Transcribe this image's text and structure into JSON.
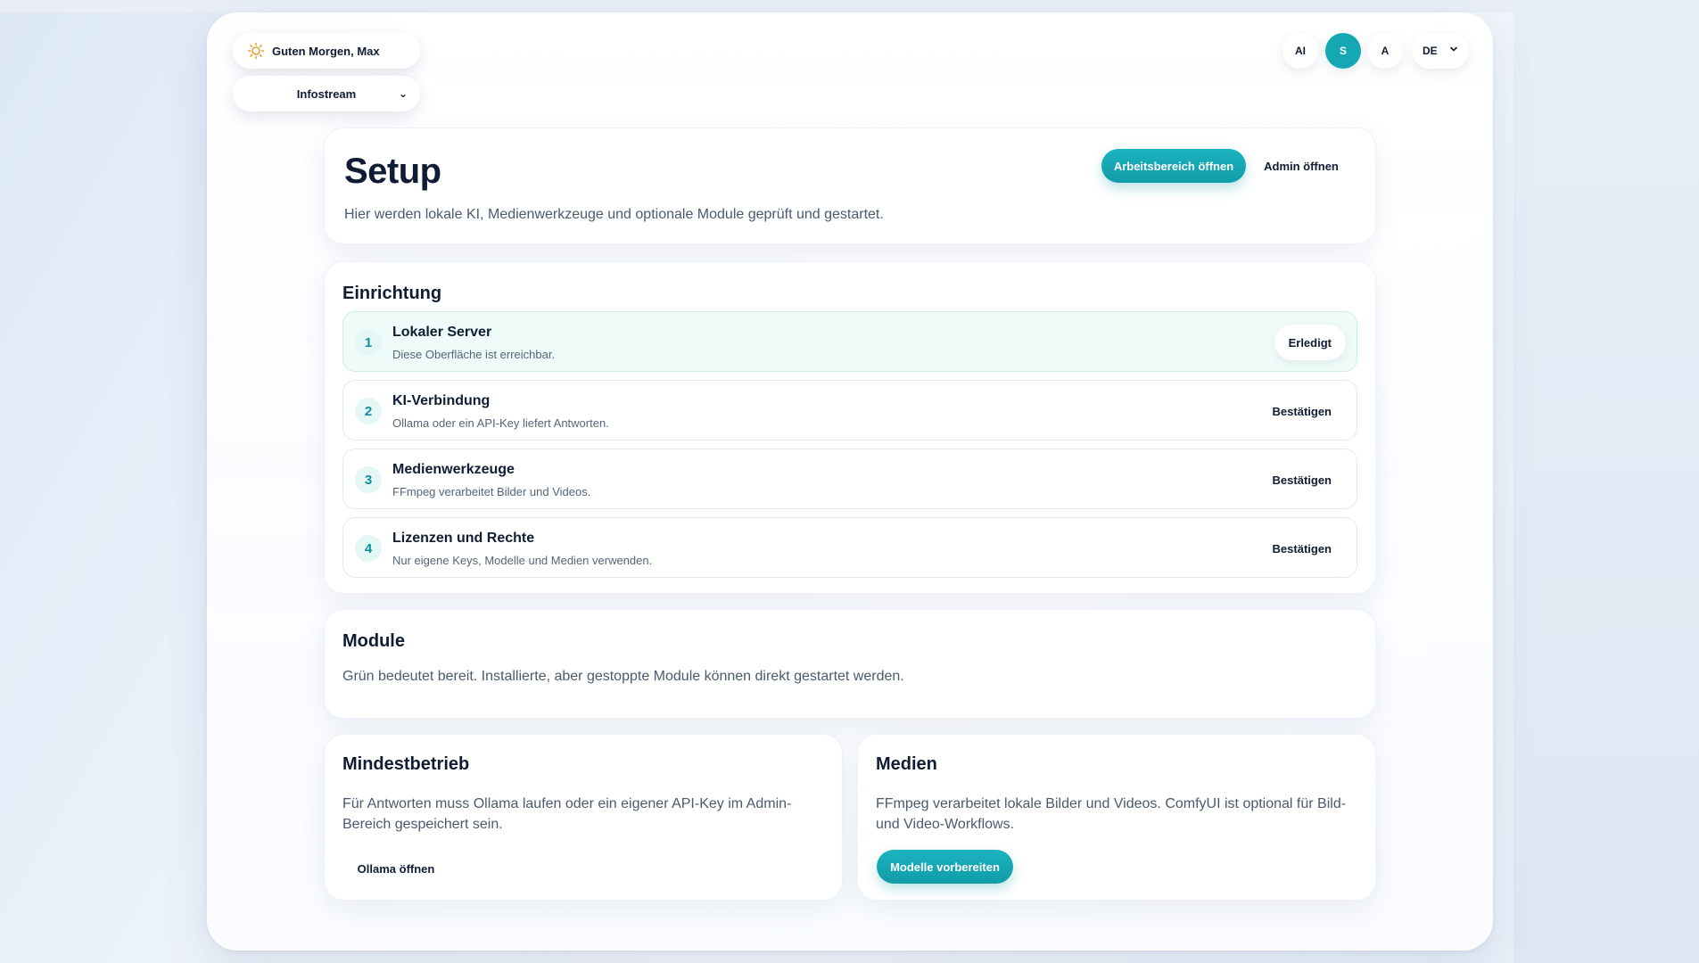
{
  "header": {
    "greeting": "Guten Morgen, Max",
    "workspace": "Infostream",
    "controls": [
      {
        "label": "AI",
        "active": false
      },
      {
        "label": "S",
        "active": true
      },
      {
        "label": "A",
        "active": false
      }
    ],
    "language": "DE"
  },
  "setup": {
    "title": "Setup",
    "subtitle": "Hier werden lokale KI, Medienwerkzeuge und optionale Module geprüft und gestartet.",
    "open_workspace_label": "Arbeitsbereich öffnen",
    "open_admin_label": "Admin öffnen"
  },
  "einrichtung": {
    "title": "Einrichtung",
    "steps": [
      {
        "number": "1",
        "title": "Lokaler Server",
        "description": "Diese Oberfläche ist erreichbar.",
        "action": "Erledigt",
        "done": true
      },
      {
        "number": "2",
        "title": "KI-Verbindung",
        "description": "Ollama oder ein API-Key liefert Antworten.",
        "action": "Bestätigen",
        "done": false
      },
      {
        "number": "3",
        "title": "Medienwerkzeuge",
        "description": "FFmpeg verarbeitet Bilder und Videos.",
        "action": "Bestätigen",
        "done": false
      },
      {
        "number": "4",
        "title": "Lizenzen und Rechte",
        "description": "Nur eigene Keys, Modelle und Medien verwenden.",
        "action": "Bestätigen",
        "done": false
      }
    ]
  },
  "module": {
    "title": "Module",
    "description": "Grün bedeutet bereit. Installierte, aber gestoppte Module können direkt gestartet werden."
  },
  "mindestbetrieb": {
    "title": "Mindestbetrieb",
    "description": "Für Antworten muss Ollama laufen oder ein eigener API-Key im Admin-Bereich gespeichert sein.",
    "button_label": "Ollama öffnen"
  },
  "medien": {
    "title": "Medien",
    "description": "FFmpeg verarbeitet lokale Bilder und Videos. ComfyUI ist optional für Bild- und Video-Workflows.",
    "button_label": "Modelle vorbereiten"
  },
  "colors": {
    "accent": "#14a7b4",
    "done_background": "#eefbf8",
    "text": "#0f1c33"
  },
  "icons": {
    "greeting": "sun-icon",
    "dropdown": "chevron-down-icon"
  }
}
